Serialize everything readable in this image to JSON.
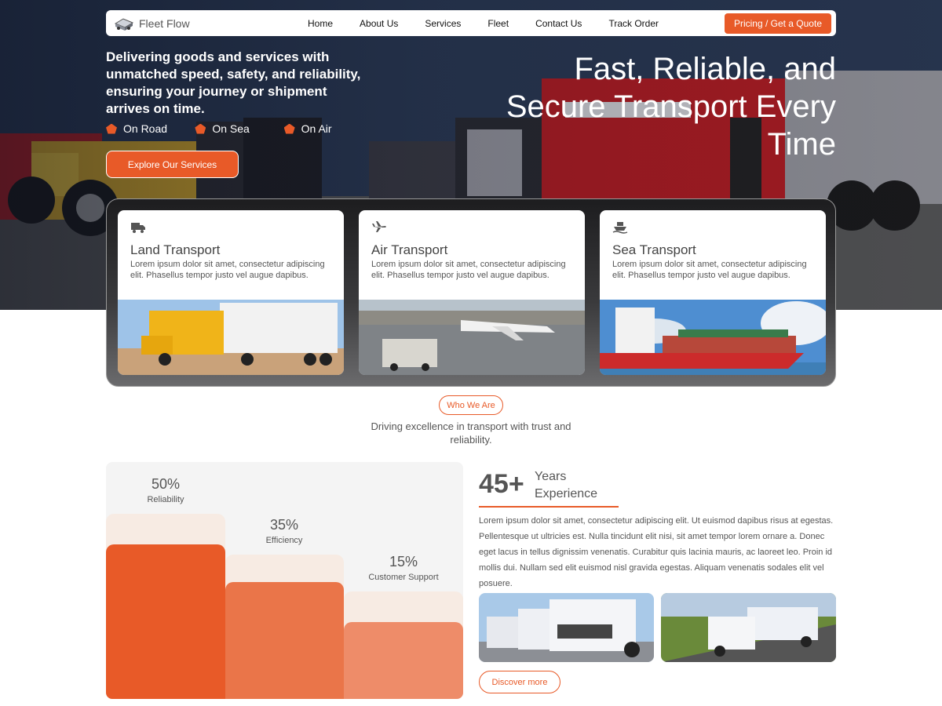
{
  "brand": {
    "name": "Fleet Flow",
    "logo_icon": "truck-logo-icon"
  },
  "nav": {
    "links": [
      "Home",
      "About Us",
      "Services",
      "Fleet",
      "Contact Us",
      "Track Order"
    ],
    "cta": "Pricing / Get a Quote"
  },
  "hero": {
    "lead": "Delivering goods and services with unmatched speed, safety, and reliability, ensuring your journey or shipment arrives on time.",
    "modes": [
      "On Road",
      "On Sea",
      "On Air"
    ],
    "explore_label": "Explore Our Services",
    "title": "Fast, Reliable, and Secure Transport Every Time"
  },
  "services": [
    {
      "icon": "truck-icon",
      "title": "Land Transport",
      "text": "Lorem ipsum dolor sit amet, consectetur adipiscing elit. Phasellus tempor justo vel augue dapibus."
    },
    {
      "icon": "plane-icon",
      "title": "Air Transport",
      "text": "Lorem ipsum dolor sit amet, consectetur adipiscing elit. Phasellus tempor justo vel augue dapibus."
    },
    {
      "icon": "ship-icon",
      "title": "Sea Transport",
      "text": "Lorem ipsum dolor sit amet, consectetur adipiscing elit. Phasellus tempor justo vel augue dapibus."
    }
  ],
  "who": {
    "badge": "Who We Are",
    "subtitle": "Driving excellence in transport with trust and reliability."
  },
  "stats": [
    {
      "value": "50%",
      "label": "Reliability",
      "fraction": 0.65,
      "color": "#e85a28"
    },
    {
      "value": "35%",
      "label": "Efficiency",
      "fraction": 0.49,
      "color": "#ea7549"
    },
    {
      "value": "15%",
      "label": "Customer Support",
      "fraction": 0.32,
      "color": "#ee8c69"
    }
  ],
  "experience": {
    "number": "45+",
    "label_line1": "Years",
    "label_line2": "Experience",
    "text": "Lorem ipsum dolor sit amet, consectetur adipiscing elit. Ut euismod dapibus risus at egestas. Pellentesque ut ultricies est. Nulla tincidunt elit nisi, sit amet tempor lorem ornare a. Donec eget lacus in tellus dignissim venenatis. Curabitur quis lacinia mauris, ac laoreet leo. Proin id mollis dui. Nullam sed elit euismod nisl gravida egestas. Aliquam venenatis sodales elit vel posuere.",
    "discover_label": "Discover more"
  },
  "colors": {
    "accent": "#e85a28",
    "navy": "#1c2a44"
  }
}
